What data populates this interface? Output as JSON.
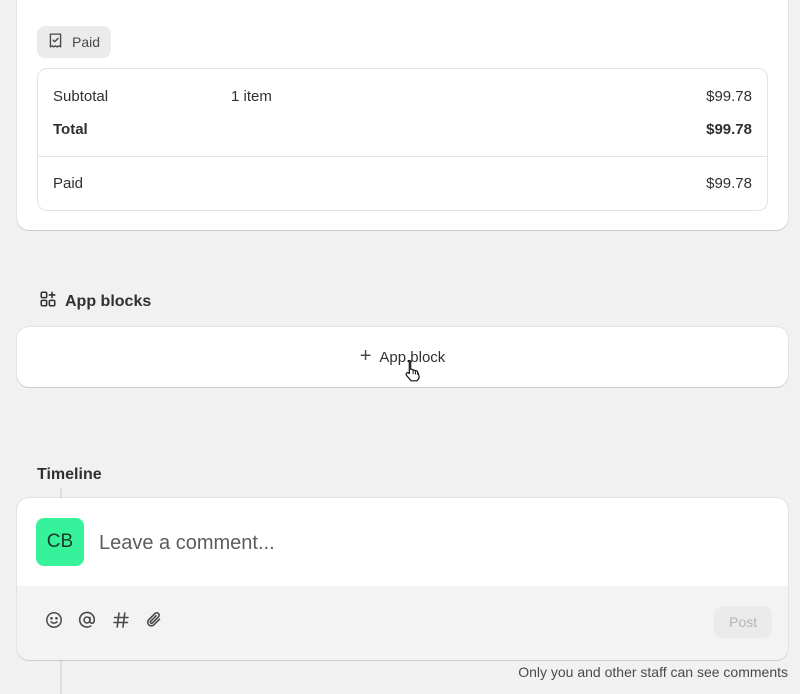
{
  "payment": {
    "status_badge": "Paid",
    "status_icon": "receipt-check-icon",
    "rows": [
      {
        "label": "Subtotal",
        "detail": "1 item",
        "amount": "$99.78"
      },
      {
        "label": "Total",
        "detail": "",
        "amount": "$99.78"
      },
      {
        "label": "Paid",
        "detail": "",
        "amount": "$99.78"
      }
    ]
  },
  "app_blocks": {
    "heading": "App blocks",
    "heading_icon": "apps-add-icon",
    "add_label": "App block",
    "add_icon": "plus-icon"
  },
  "timeline": {
    "heading": "Timeline",
    "avatar_initials": "CB",
    "avatar_color": "#36f29a",
    "comment_placeholder": "Leave a comment...",
    "comment_value": "",
    "tools": [
      "emoji-icon",
      "mention-icon",
      "hashtag-icon",
      "attachment-icon"
    ],
    "post_label": "Post",
    "footnote": "Only you and other staff can see comments"
  }
}
